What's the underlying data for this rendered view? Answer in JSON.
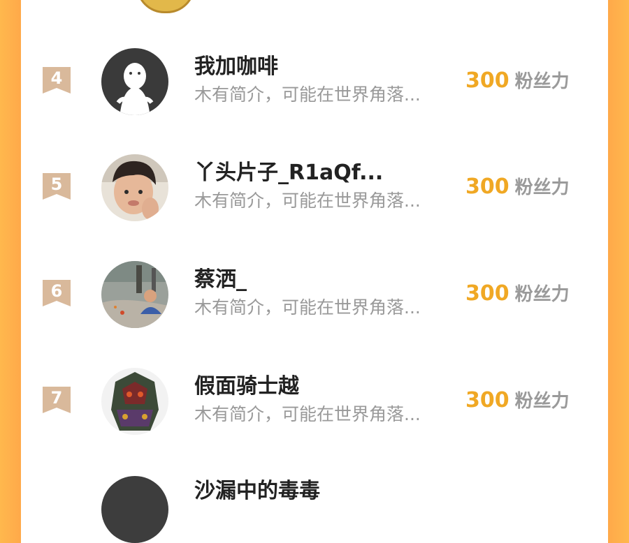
{
  "ranking": {
    "rows": [
      {
        "rank": "4",
        "name": "我加咖啡",
        "bio": "木有简介，可能在世界角落...",
        "score": "300",
        "unit": "粉丝力",
        "avatar": "default-ghost-avatar"
      },
      {
        "rank": "5",
        "name": "丫头片子_R1aQf...",
        "bio": "木有简介，可能在世界角落...",
        "score": "300",
        "unit": "粉丝力",
        "avatar": "child-photo-avatar"
      },
      {
        "rank": "6",
        "name": "蔡洒_",
        "bio": "木有简介，可能在世界角落...",
        "score": "300",
        "unit": "粉丝力",
        "avatar": "outdoor-photo-avatar"
      },
      {
        "rank": "7",
        "name": "假面骑士越",
        "bio": "木有简介，可能在世界角落...",
        "score": "300",
        "unit": "粉丝力",
        "avatar": "armored-hero-avatar"
      }
    ],
    "partial_next_name": "沙漏中的毒毒"
  },
  "colors": {
    "side_orange": "#ffb84d",
    "score_gold": "#f0a824",
    "badge_tan": "#d9b99b"
  }
}
